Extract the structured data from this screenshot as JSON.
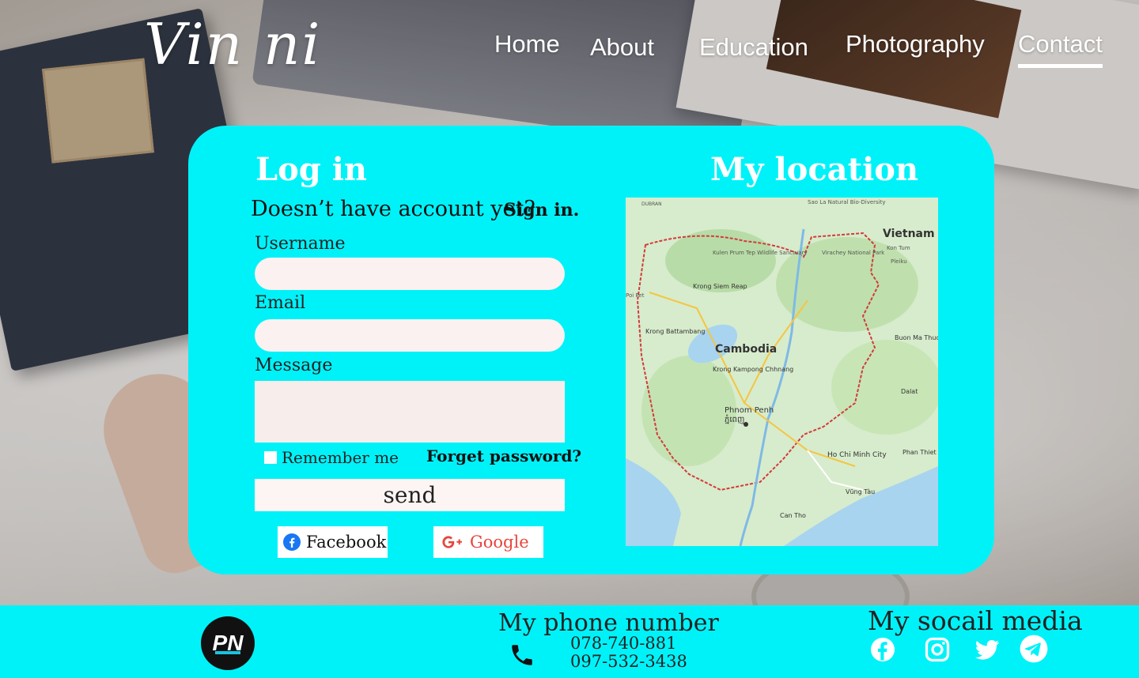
{
  "brand": {
    "logo_text": "Vin ni"
  },
  "nav": {
    "items": [
      {
        "label": "Home"
      },
      {
        "label": "About"
      },
      {
        "label": "Education"
      },
      {
        "label": "Photography"
      },
      {
        "label": "Contact",
        "active": true
      }
    ]
  },
  "login": {
    "title": "Log in",
    "no_account_text": "Doesn’t have account yet?",
    "sign_in_link": "Sign in.",
    "username_label": "Username",
    "username_value": "",
    "email_label": "Email",
    "email_value": "",
    "message_label": "Message",
    "message_value": "",
    "remember_label": "Remember me",
    "forgot_link": "Forget password?",
    "send_label": "send",
    "facebook_label": "Facebook",
    "google_label": "Google"
  },
  "location": {
    "title": "My location",
    "map_labels": {
      "country": "Cambodia",
      "neighbor": "Vietnam",
      "capital": "Phnom Penh",
      "capital_khmer": "ភ្នំពេញ",
      "siem_reap": "Krong Siem Reap",
      "battambang": "Krong Battambang",
      "kampong_chhnang": "Krong Kampong Chhnang",
      "ho_chi_minh": "Ho Chi Minh City",
      "can_tho": "Can Tho",
      "vung_tau": "Vũng Tàu",
      "phan_thiet": "Phan Thiet",
      "dalat": "Dalat",
      "buon_ma": "Buon Ma Thuot",
      "kulen": "Kulen Prum Tep Wildlife Sanctuary",
      "virachey": "Virachey National Park",
      "pleiku": "Pleiku",
      "kon_tum": "Kon Tum",
      "sao_la": "Sao La Natural Bio-Diversity",
      "poi_pet": "Poi Pet",
      "duban": "DUBRAN"
    },
    "colors": {
      "land": "#cfe9c6",
      "water": "#a8d4f0",
      "border": "#d23b3b"
    }
  },
  "footer": {
    "logo_text": "PN",
    "phone_title": "My phone number",
    "phone_1": "078-740-881",
    "phone_2": "097-532-3438",
    "social_title": "My socail media",
    "social_icons": [
      "facebook-icon",
      "instagram-icon",
      "twitter-icon",
      "telegram-icon"
    ]
  },
  "colors": {
    "accent": "#00f2f9",
    "field_bg": "#faf1f0",
    "text_dark": "#222222"
  }
}
